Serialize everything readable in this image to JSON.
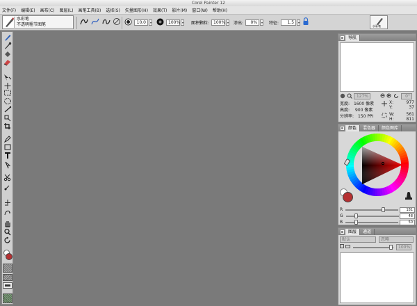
{
  "window": {
    "title": "Corel Painter 12"
  },
  "menu": [
    "文件(F)",
    "编辑(E)",
    "画布(C)",
    "图层(L)",
    "画笔工具(B)",
    "选择(S)",
    "矢量图形(H)",
    "效果(T)",
    "影片(M)",
    "窗口(W)",
    "帮助(H)"
  ],
  "property_bar": {
    "brush_category": "水彩笔",
    "brush_variant": "不透明粗节图笔",
    "size_value": "10.0",
    "opacity_value": "100%",
    "paper_texture_label": "面积颗粒:",
    "paper_texture_value": "100%",
    "blend_label": "渗出:",
    "blend_value": "0%",
    "feature_label": "特征:",
    "feature_value": "1.5",
    "right_brush_label": "水彩笔"
  },
  "navigator_panel": {
    "tab": "导航",
    "zoom_value": "127%",
    "rotate_value": "0°",
    "width_label": "宽度:",
    "width_value": "1600 像素",
    "height_label": "高度:",
    "height_value": "900 像素",
    "resolution_label": "分辨率:",
    "resolution_value": "150 PPI",
    "x_label": "X:",
    "x_value": "977",
    "y_label": "Y:",
    "y_value": "37",
    "w_label": "W:",
    "w_value": "561",
    "h_label": "H:",
    "h_value": "811"
  },
  "color_panel": {
    "tabs": [
      "颜色",
      "混色器",
      "颜色图库"
    ],
    "r_label": "R",
    "r_value": "181",
    "r_fraction": 0.71,
    "g_label": "G",
    "g_value": "48",
    "g_fraction": 0.19,
    "b_label": "B",
    "b_value": "50",
    "b_fraction": 0.2,
    "main_color": "#b53032",
    "secondary_color": "#ffffff"
  },
  "layers_panel": {
    "tabs": [
      "图层",
      "通道"
    ],
    "composite_method": "默认",
    "composite_depth": "忽略",
    "opacity_value": "100%"
  },
  "toolbox": {
    "main_color": "#b53032",
    "secondary_color": "#ffffff"
  },
  "colors": {
    "panel_bg": "#d8d8d8",
    "canvas_bg": "#7a7a7a"
  },
  "tools": [
    "brush-icon",
    "dropper-icon",
    "paint-bucket-icon",
    "eraser-icon",
    "transform-icon",
    "layer-adjuster-icon",
    "rectangle-select-icon",
    "oval-select-icon",
    "lasso-icon",
    "magic-wand-icon",
    "selection-adjuster-icon",
    "crop-icon",
    "pen-icon",
    "shape-icon",
    "text-icon",
    "shape-selection-icon",
    "scissors-icon",
    "add-point-icon",
    "remove-point-icon",
    "convert-point-icon",
    "mirror-icon",
    "kaleidoscope-icon",
    "grabber-icon",
    "magnifier-icon",
    "rotate-page-icon"
  ]
}
